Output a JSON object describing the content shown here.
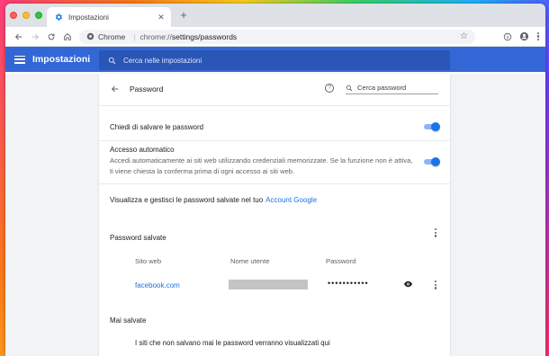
{
  "browser": {
    "tab_title": "Impostazioni",
    "tab_close": "✕",
    "new_tab": "+",
    "omnibox_site": "Chrome",
    "omnibox_url_prefix": "chrome://",
    "omnibox_url_path": "settings/passwords"
  },
  "header": {
    "title": "Impostazioni",
    "search_placeholder": "Cerca nelle impostazioni"
  },
  "passwords": {
    "title": "Password",
    "search_placeholder": "Cerca password",
    "offer_to_save": {
      "label": "Chiedi di salvare le password",
      "enabled": true
    },
    "auto_signin": {
      "label": "Accesso automatico",
      "description_line1": "Accedi automaticamente ai siti web utilizzando credenziali memorizzate. Se la funzione non è attiva,",
      "description_line2": "ti viene chiesta la conferma prima di ogni accesso ai siti web.",
      "enabled": true
    },
    "manage_text": "Visualizza e gestisci le password salvate nel tuo",
    "manage_link": "Account Google",
    "saved_section_title": "Password salvate",
    "columns": [
      "Sito web",
      "Nome utente",
      "Password"
    ],
    "saved_entries": [
      {
        "site": "facebook.com",
        "password_mask": "•••••••••••"
      }
    ],
    "never_saved_title": "Mai salvate",
    "never_saved_empty": "I siti che non salvano mai le password verranno visualizzati qui"
  },
  "colors": {
    "header_blue": "#3367d6",
    "toggle_on": "#1a73e8",
    "link": "#1a73e8"
  }
}
